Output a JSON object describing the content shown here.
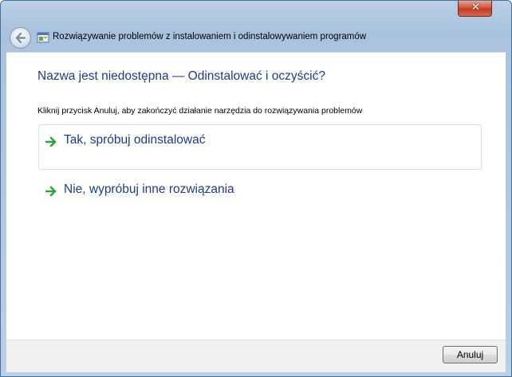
{
  "window": {
    "caption": "",
    "close_symbol": "✕",
    "colors": {
      "heading": "#1e3b8c",
      "arrow": "#2ea33a",
      "close": "#c23a21"
    }
  },
  "navbar": {
    "back_icon": "back-arrow-icon",
    "app_icon": "troubleshooter-icon",
    "title": "Rozwiązywanie problemów z instalowaniem i odinstalowywaniem programów"
  },
  "content": {
    "heading": "Nazwa jest niedostępna — Odinstalować i oczyścić?",
    "instruction": "Kliknij przycisk Anuluj, aby zakończyć działanie narzędzia do rozwiązywania problemów",
    "options": [
      {
        "label": "Tak, spróbuj odinstalować",
        "icon": "green-arrow-icon"
      },
      {
        "label": "Nie, wypróbuj inne rozwiązania",
        "icon": "green-arrow-icon"
      }
    ]
  },
  "footer": {
    "cancel_label": "Anuluj"
  }
}
